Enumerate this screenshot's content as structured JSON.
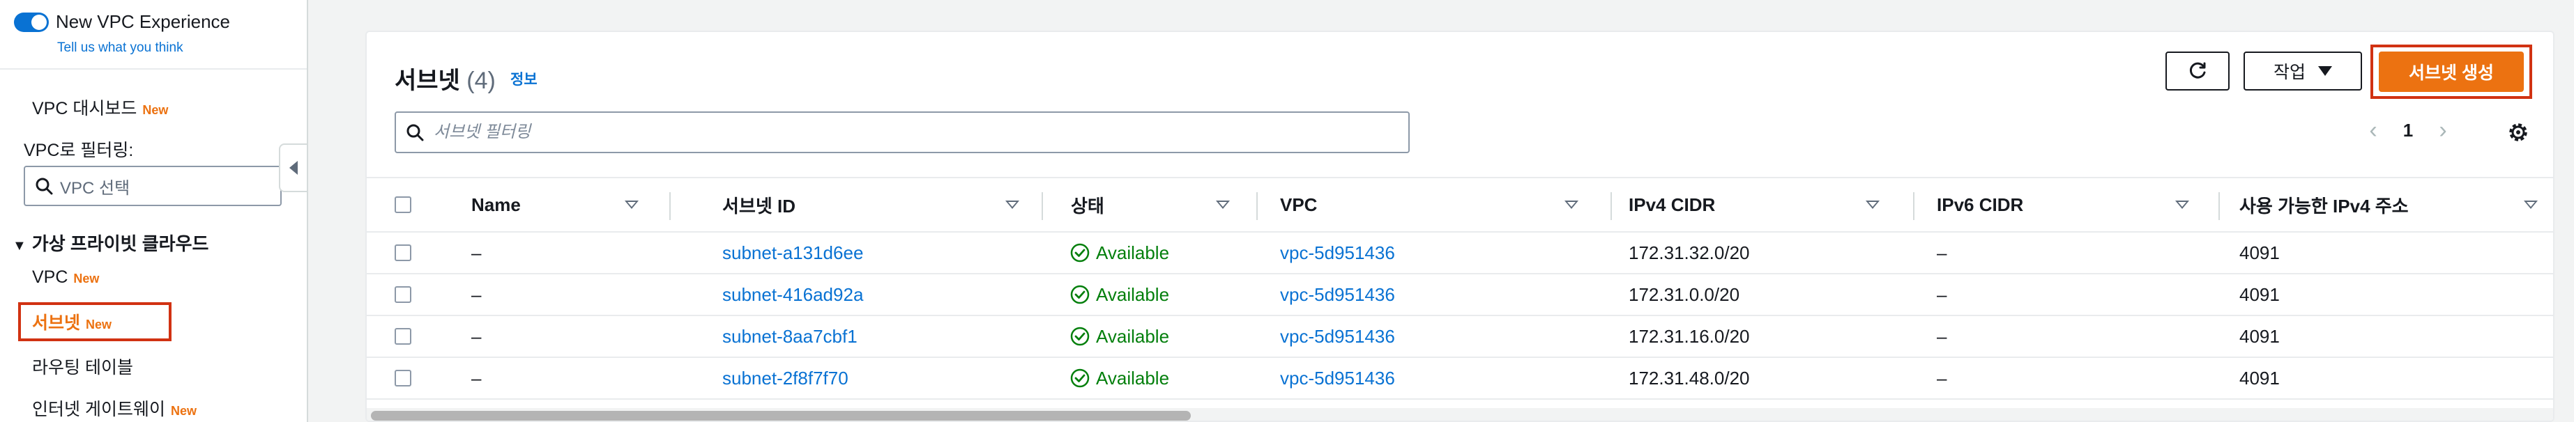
{
  "sidebar": {
    "toggle_label": "New VPC Experience",
    "feedback_link": "Tell us what you think",
    "badge_new": "New",
    "items": [
      {
        "label": "VPC 대시보드",
        "badge": "New"
      },
      {
        "label": "VPC",
        "badge": "New"
      },
      {
        "label": "서브넷",
        "badge": "New"
      },
      {
        "label": "라우팅 테이블",
        "badge": ""
      },
      {
        "label": "인터넷 게이트웨이",
        "badge": "New"
      }
    ],
    "filter_label": "VPC로 필터링:",
    "filter_placeholder": "VPC 선택",
    "section_title": "가상 프라이빗 클라우드"
  },
  "panel": {
    "title": "서브넷",
    "count": "(4)",
    "info_link": "정보",
    "action_button": "작업",
    "create_button": "서브넷 생성",
    "search_placeholder": "서브넷 필터링",
    "current_page": "1"
  },
  "table": {
    "columns": [
      "Name",
      "서브넷 ID",
      "상태",
      "VPC",
      "IPv4 CIDR",
      "IPv6 CIDR",
      "사용 가능한 IPv4 주소"
    ],
    "rows": [
      {
        "name": "–",
        "subnet_id": "subnet-a131d6ee",
        "status": "Available",
        "vpc": "vpc-5d951436",
        "ipv4": "172.31.32.0/20",
        "ipv6": "–",
        "available_ips": "4091"
      },
      {
        "name": "–",
        "subnet_id": "subnet-416ad92a",
        "status": "Available",
        "vpc": "vpc-5d951436",
        "ipv4": "172.31.0.0/20",
        "ipv6": "–",
        "available_ips": "4091"
      },
      {
        "name": "–",
        "subnet_id": "subnet-8aa7cbf1",
        "status": "Available",
        "vpc": "vpc-5d951436",
        "ipv4": "172.31.16.0/20",
        "ipv6": "–",
        "available_ips": "4091"
      },
      {
        "name": "–",
        "subnet_id": "subnet-2f8f7f70",
        "status": "Available",
        "vpc": "vpc-5d951436",
        "ipv4": "172.31.48.0/20",
        "ipv6": "–",
        "available_ips": "4091"
      }
    ]
  },
  "icons": {
    "refresh": "refresh-icon",
    "search": "search-icon",
    "settings": "gear-icon",
    "status_ok": "check-circle-icon"
  },
  "colors": {
    "accent": "#ec7211",
    "link": "#0972d3",
    "success": "#037f0c",
    "highlight": "#d13212"
  }
}
